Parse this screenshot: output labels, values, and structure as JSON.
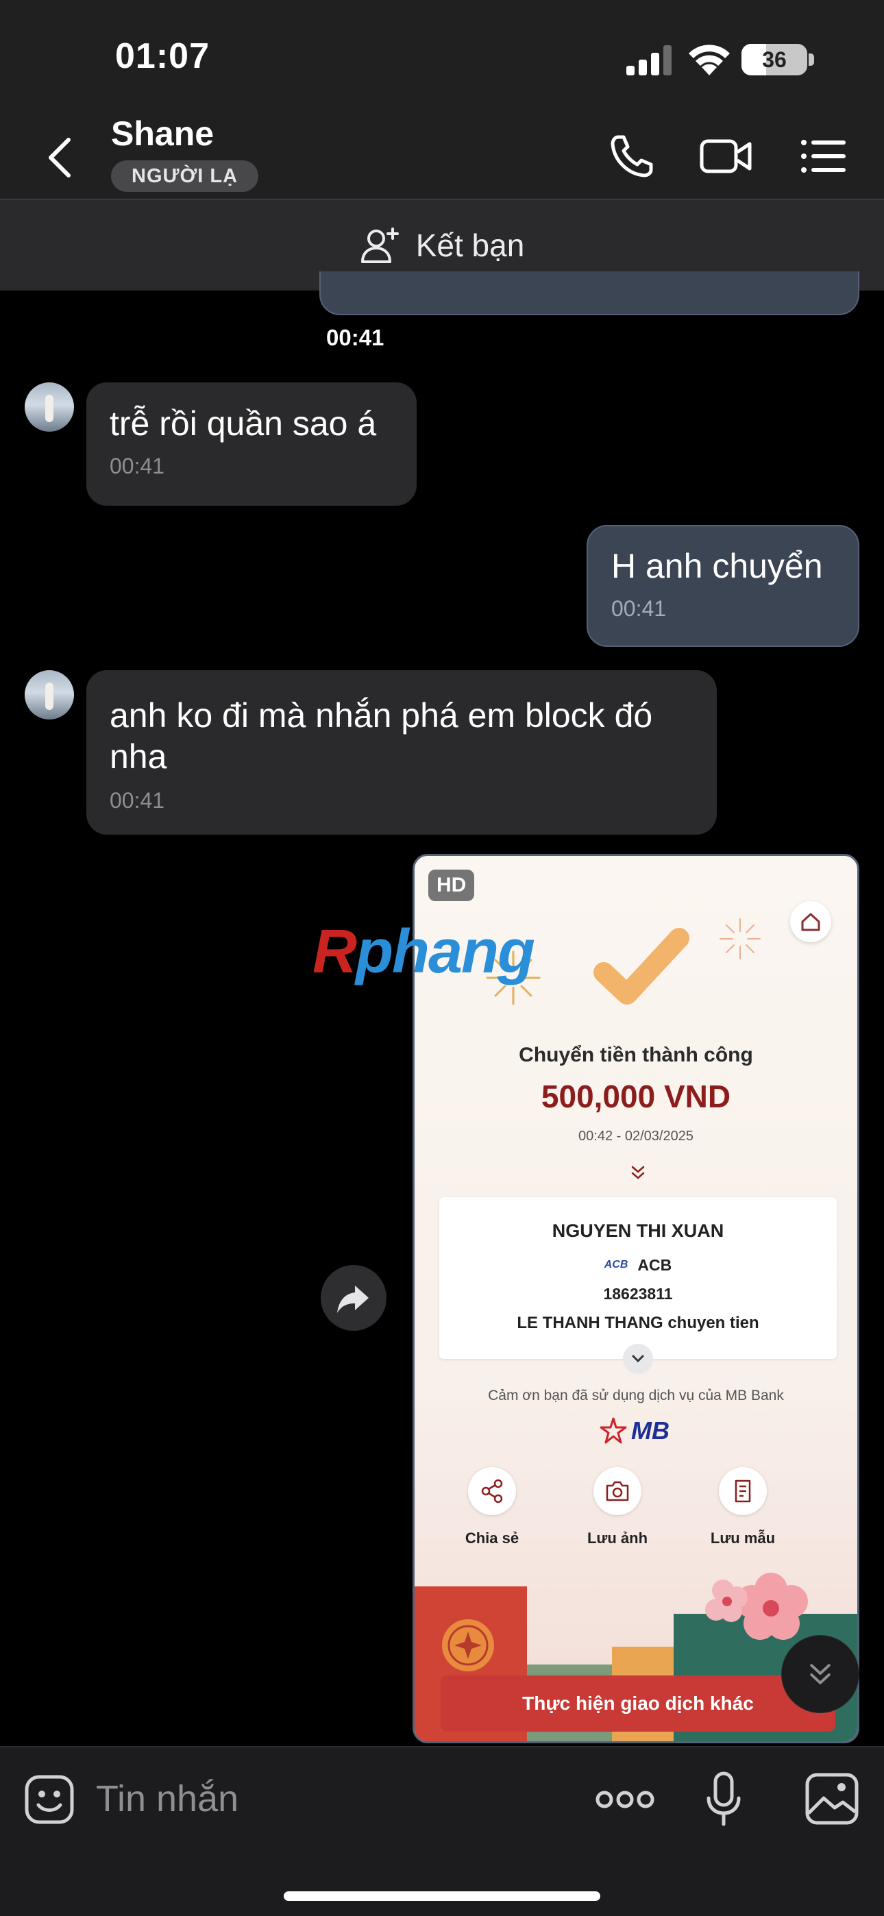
{
  "status_bar": {
    "time": "01:07",
    "battery": "36"
  },
  "header": {
    "contact_name": "Shane",
    "contact_badge": "NGƯỜI LẠ"
  },
  "friend_bar": {
    "label": "Kết bạn"
  },
  "messages": [
    {
      "timestamp": "00:41"
    },
    {
      "direction": "in",
      "text": "trễ rồi quần sao á",
      "time": "00:41"
    },
    {
      "direction": "out",
      "text": "H anh chuyển",
      "time": "00:41"
    },
    {
      "direction": "in",
      "text": "anh ko đi mà nhắn phá em block đó nha",
      "time": "00:41"
    }
  ],
  "image_message": {
    "badge": "HD",
    "watermark_a": "R",
    "watermark_b": "phang",
    "receipt": {
      "title": "Chuyển tiền thành công",
      "amount": "500,000 VND",
      "datetime": "00:42 - 02/03/2025",
      "recipient_name": "NGUYEN THI XUAN",
      "bank_logo": "ACB",
      "bank": "ACB",
      "account_number": "18623811",
      "description": "LE THANH THANG chuyen tien",
      "thanks": "Cảm ơn bạn đã sử dụng dịch vụ của MB Bank",
      "brand": "MB",
      "actions": [
        "Chia sẻ",
        "Lưu ảnh",
        "Lưu mẫu"
      ],
      "cta": "Thực hiện giao dịch khác"
    }
  },
  "input": {
    "placeholder": "Tin nhắn"
  },
  "colors": {
    "outgoing_bubble": "#3b4554",
    "incoming_bubble": "#2a2a2c",
    "amount": "#8c1d1d",
    "cta": "#c93a36"
  }
}
